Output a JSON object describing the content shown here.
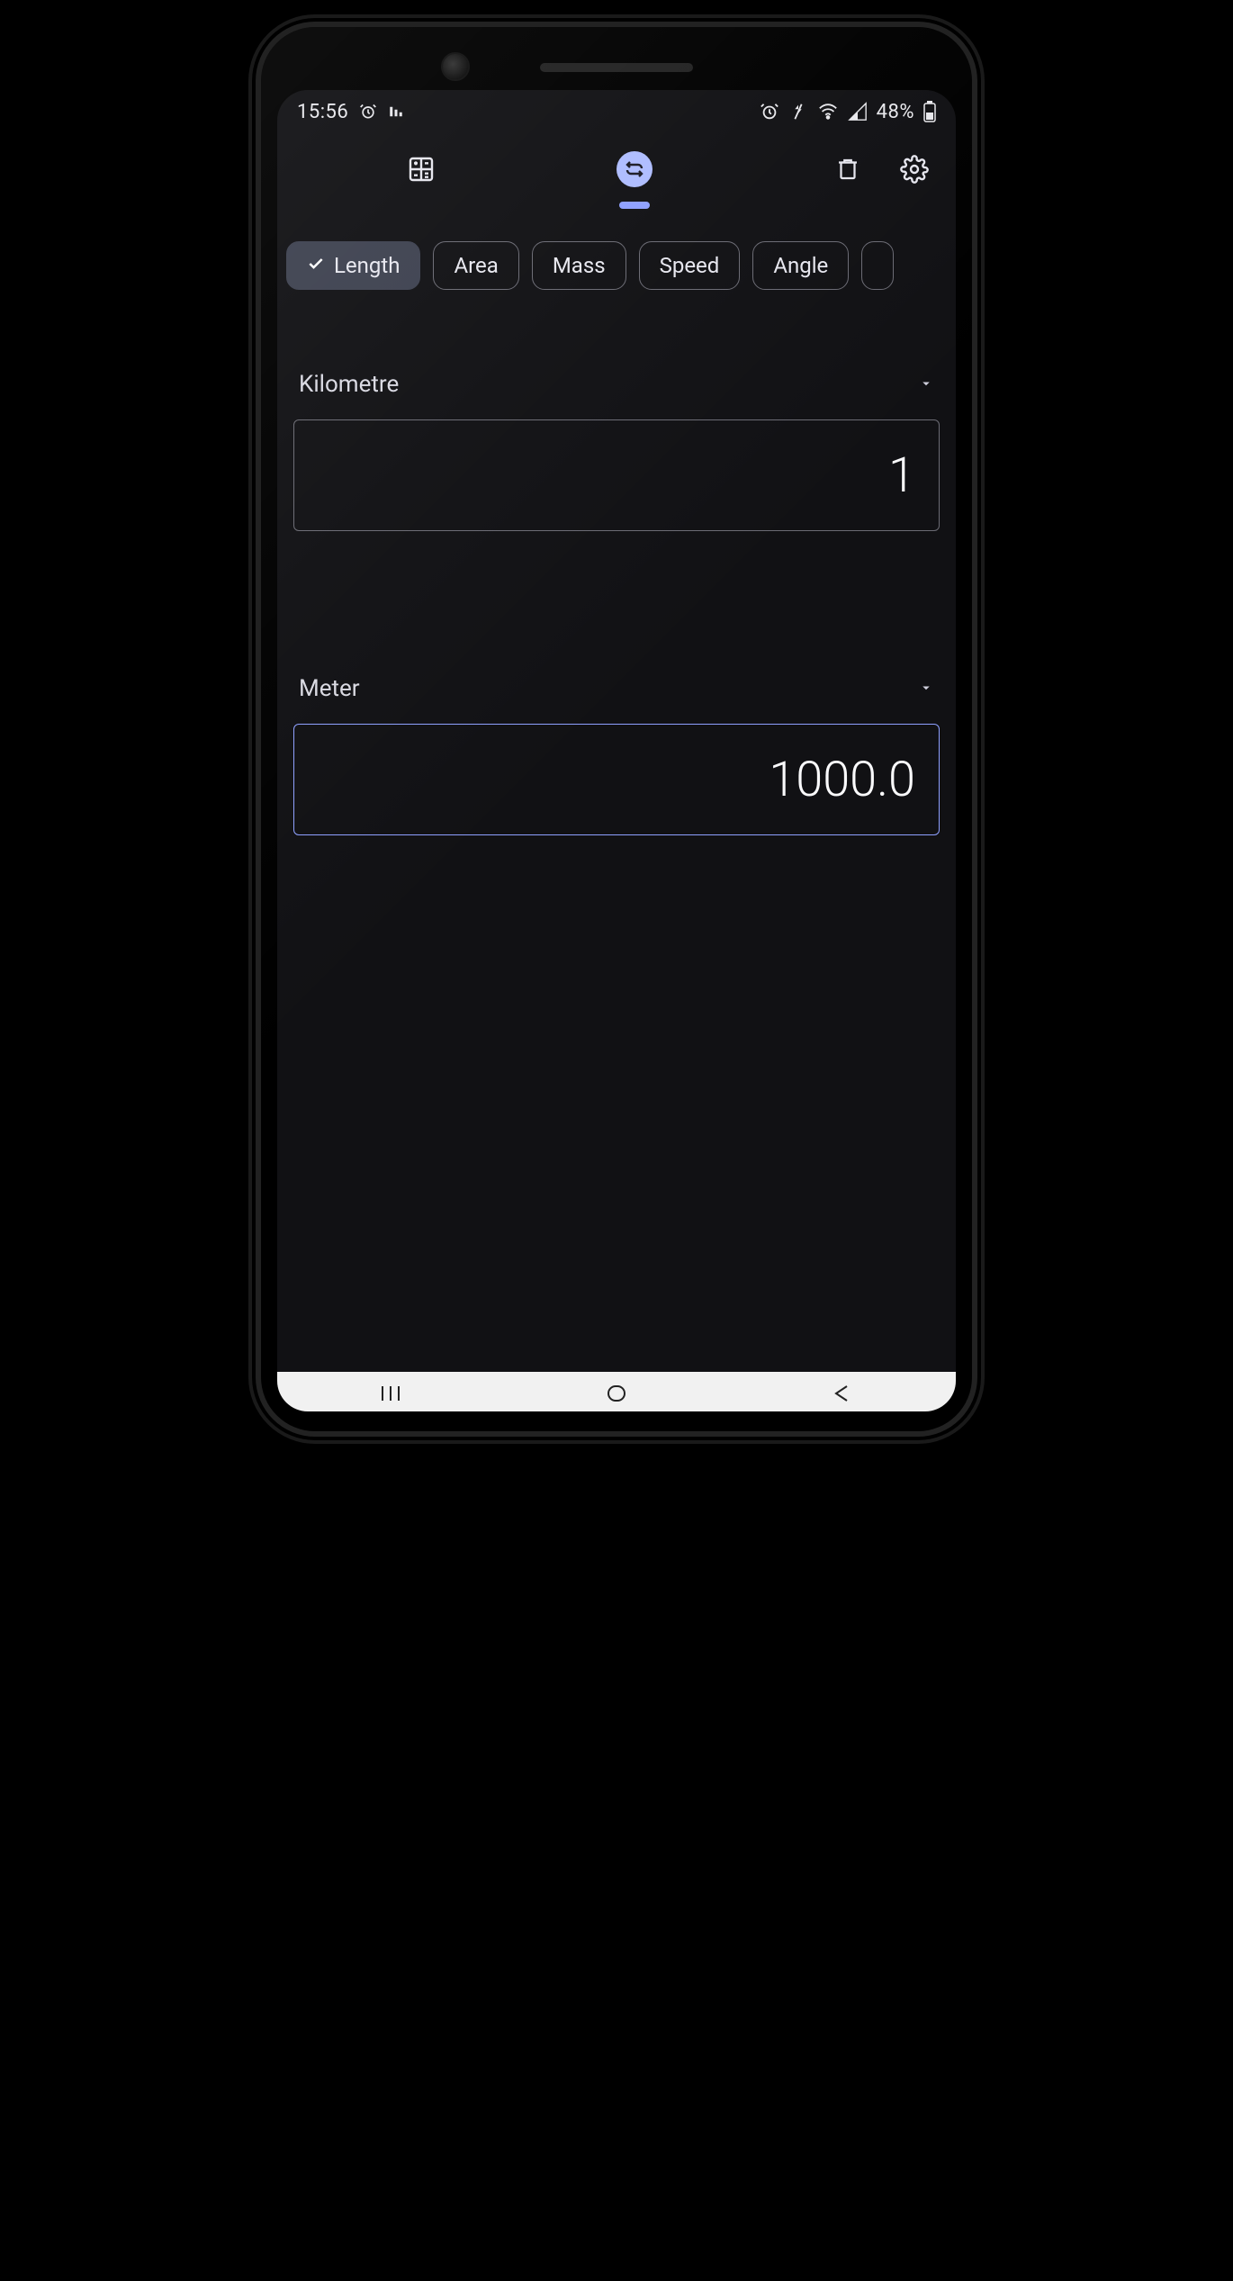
{
  "status": {
    "time": "15:56",
    "battery": "48%"
  },
  "toolbar": {
    "calculator_icon": "calculator-icon",
    "convert_icon": "convert-icon",
    "delete_icon": "trash-icon",
    "settings_icon": "gear-icon"
  },
  "chips": {
    "items": [
      {
        "label": "Length",
        "active": true
      },
      {
        "label": "Area",
        "active": false
      },
      {
        "label": "Mass",
        "active": false
      },
      {
        "label": "Speed",
        "active": false
      },
      {
        "label": "Angle",
        "active": false
      }
    ]
  },
  "converter": {
    "from_unit": "Kilometre",
    "from_value": "1",
    "to_unit": "Meter",
    "to_value": "1000.0"
  }
}
